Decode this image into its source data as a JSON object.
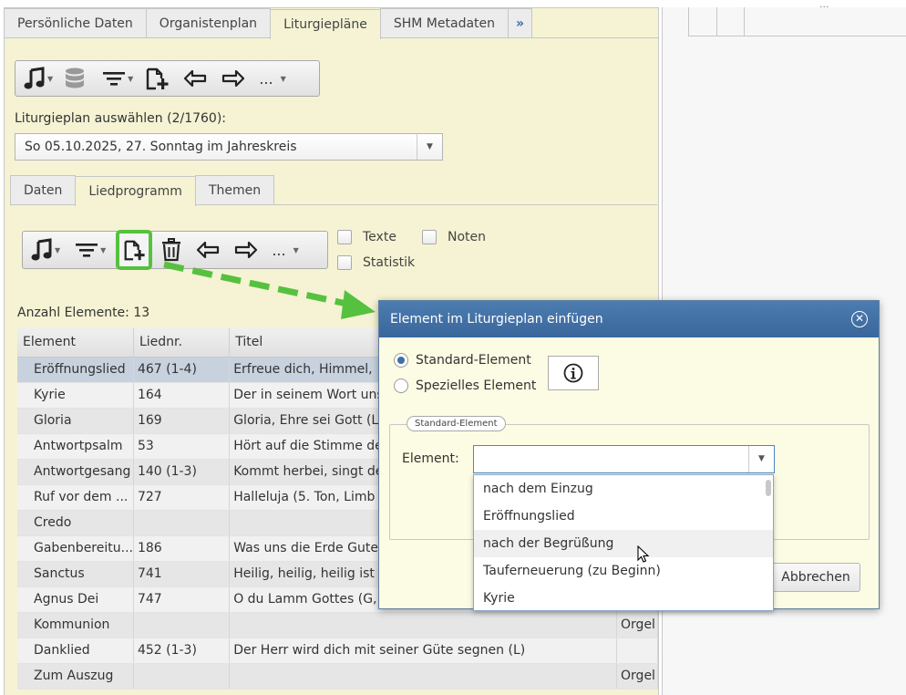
{
  "main_tabs": [
    "Persönliche Daten",
    "Organistenplan",
    "Liturgiepläne",
    "SHM Metadaten"
  ],
  "more_tabs": "»",
  "toolbar_more": "...",
  "plan_label": "Liturgieplan auswählen (2/1760):",
  "plan_select": "So 05.10.2025, 27. Sonntag im Jahreskreis",
  "sub_tabs": [
    "Daten",
    "Liedprogramm",
    "Themen"
  ],
  "checkboxes": {
    "texte": "Texte",
    "noten": "Noten",
    "statistik": "Statistik"
  },
  "count_label": "Anzahl Elemente: 13",
  "table": {
    "headers": [
      "Element",
      "Liednr.",
      "Titel"
    ],
    "rows": [
      [
        "Eröffnungslied",
        "467 (1-4)",
        "Erfreue dich, Himmel,",
        ""
      ],
      [
        "Kyrie",
        "164",
        "Der in seinem Wort uns",
        ""
      ],
      [
        "Gloria",
        "169",
        "Gloria, Ehre sei Gott (L",
        ""
      ],
      [
        "Antwortpsalm",
        "53",
        "Hört auf die Stimme de",
        ""
      ],
      [
        "Antwortgesang",
        "140 (1-3)",
        "Kommt herbei, singt de",
        ""
      ],
      [
        "Ruf vor dem ...",
        "727",
        "Halleluja (5. Ton, Limb",
        ""
      ],
      [
        "Credo",
        "",
        "",
        ""
      ],
      [
        "Gabenbereitu...",
        "186",
        "Was uns die Erde Gute",
        ""
      ],
      [
        "Sanctus",
        "741",
        "Heilig, heilig, heilig ist",
        ""
      ],
      [
        "Agnus Dei",
        "747",
        "O du Lamm Gottes (G,",
        ""
      ],
      [
        "Kommunion",
        "",
        "",
        "Orgel"
      ],
      [
        "Danklied",
        "452 (1-3)",
        "Der Herr wird dich mit seiner Güte segnen (L)",
        ""
      ],
      [
        "Zum Auszug",
        "",
        "",
        "Orgel"
      ]
    ]
  },
  "dialog": {
    "title": "Element im Liturgieplan einfügen",
    "radio_standard": "Standard-Element",
    "radio_special": "Spezielles Element",
    "legend": "Standard-Element",
    "element_label": "Element:",
    "element_value": "",
    "cancel": "Abbrechen",
    "options": [
      "nach dem Einzug",
      "Eröffnungslied",
      "nach der Begrüßung",
      "Tauferneuerung (zu Beginn)",
      "Kyrie"
    ]
  },
  "right_dots": "...",
  "colors": {
    "highlight": "#56c13f",
    "dialog_title": "#3f6fa3",
    "panel": "#f5f3d3"
  }
}
